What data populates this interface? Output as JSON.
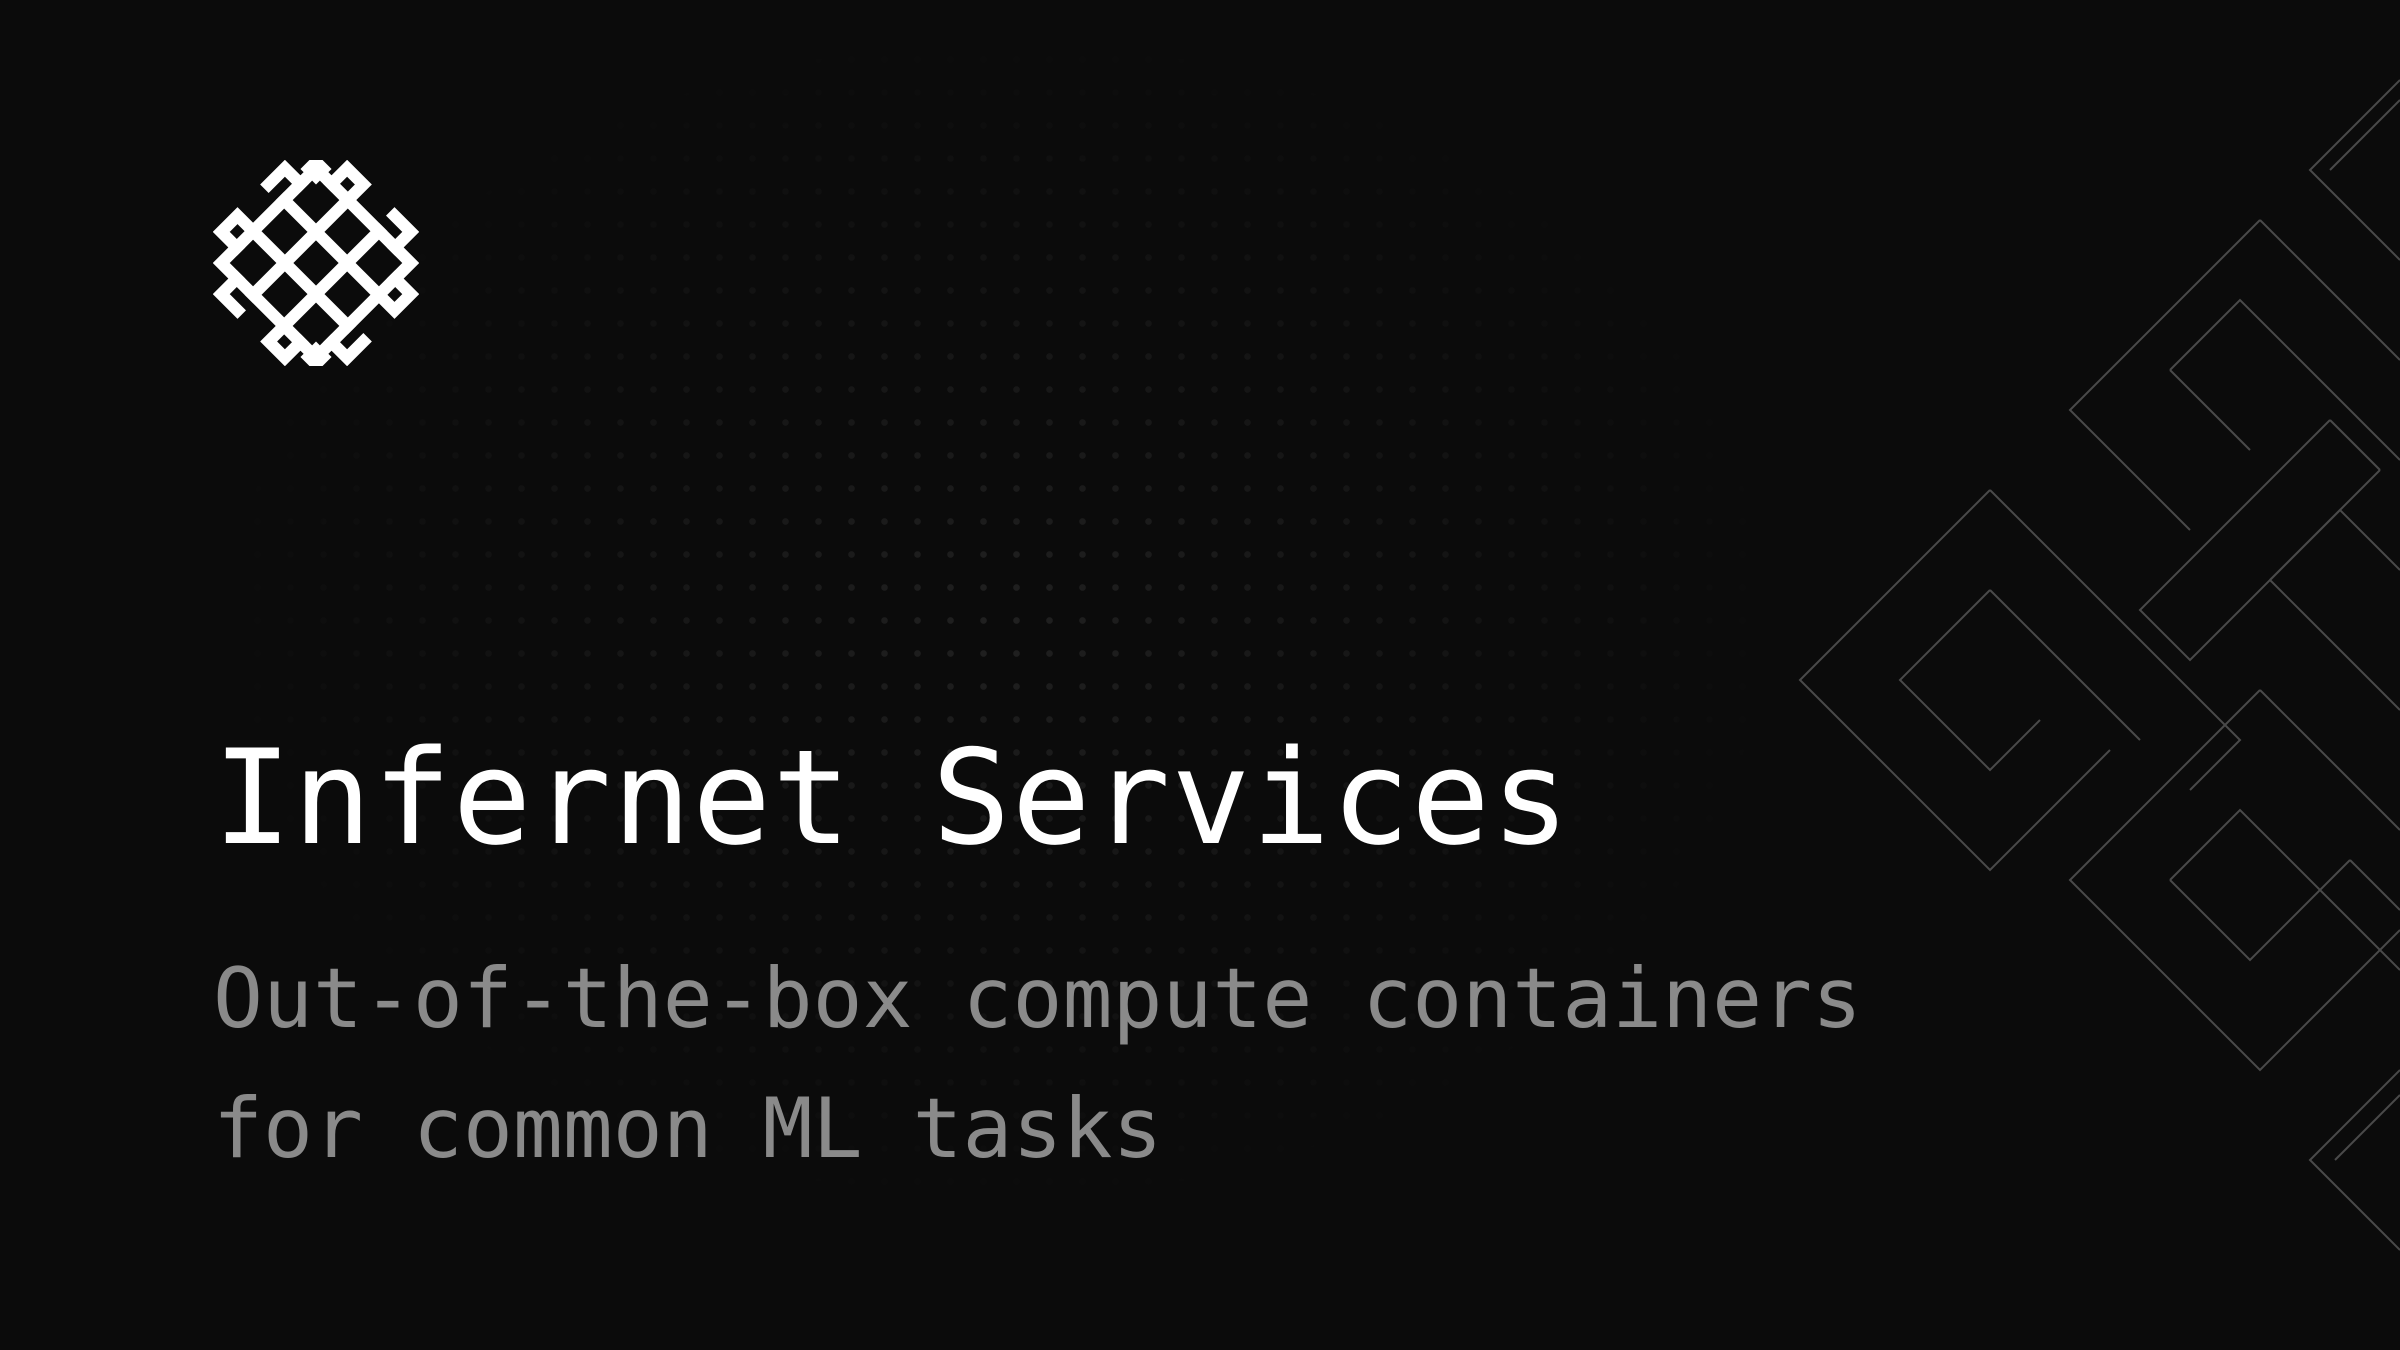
{
  "slide": {
    "title": "Infernet Services",
    "subtitle_line1": "Out-of-the-box compute containers",
    "subtitle_line2": "for common ML tasks"
  },
  "icons": {
    "logo": "knot-logo-icon",
    "decoration": "knot-outline-decoration-icon"
  },
  "colors": {
    "background": "#0b0b0b",
    "title": "#ffffff",
    "subtitle": "#8a8a8a",
    "logo": "#ffffff",
    "decoration_stroke": "#4a4a4a"
  }
}
